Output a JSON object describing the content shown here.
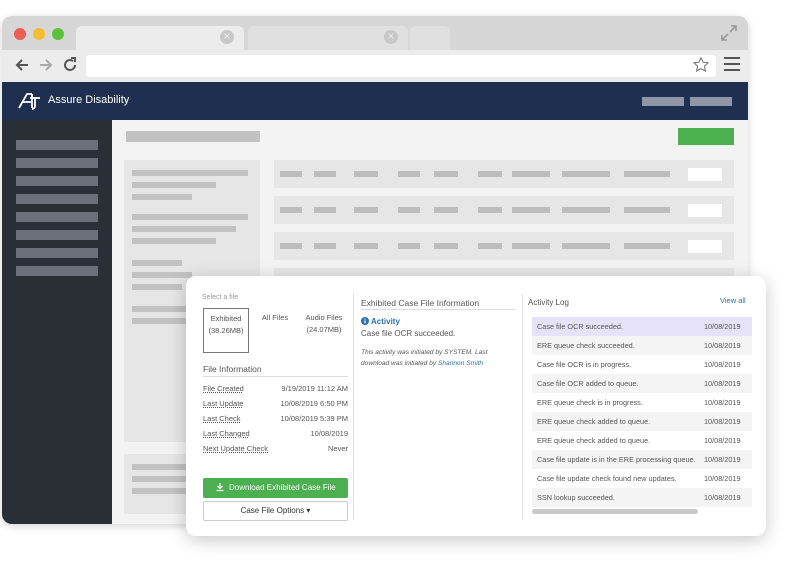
{
  "browser": {
    "tab_close_glyph": "×",
    "colors": {
      "close": "#ee5c54",
      "minimize": "#f7bc2f",
      "maximize": "#59c23d"
    },
    "icons": [
      "back-arrow-icon",
      "forward-arrow-icon",
      "reload-icon",
      "star-icon",
      "hamburger-menu-icon",
      "expand-icon"
    ]
  },
  "app": {
    "brand": "Assure Disability",
    "colors": {
      "header": "#1e2f4f",
      "sidebar": "#2a2e35",
      "accent_green": "#4caf50",
      "link_blue": "#2a6fb5",
      "highlight": "#e6e2fa"
    }
  },
  "file_panel": {
    "select_label": "Select a file",
    "tabs": [
      {
        "label": "Exhibited",
        "size": "(38.26MB)"
      },
      {
        "label": "All Files",
        "size": ""
      },
      {
        "label": "Audio Files",
        "size": "(24.07MB)"
      }
    ],
    "info_title": "File Information",
    "info": [
      {
        "label": "File Created",
        "value": "9/19/2019 11:12 AM"
      },
      {
        "label": "Last Update",
        "value": "10/08/2019 6:50 PM"
      },
      {
        "label": "Last Check",
        "value": "10/08/2019 5:39 PM"
      },
      {
        "label": "Last Changed",
        "value": "10/08/2019"
      },
      {
        "label": "Next Update Check",
        "value": "Never"
      }
    ],
    "download_button": "Download Exhibited Case File",
    "options_button": "Case File Options ▾"
  },
  "exhibited_info": {
    "title": "Exhibited Case File Information",
    "activity_label": "Activity",
    "activity_text": "Case file OCR succeeded.",
    "note_prefix": "This activity was initiated by SYSTEM. Last download was initiated by ",
    "note_user": "Shannon Smith"
  },
  "activity_log": {
    "title": "Activity Log",
    "view_all": "View all",
    "entries": [
      {
        "message": "Case file OCR succeeded.",
        "date": "10/08/2019",
        "highlighted": true
      },
      {
        "message": "ERE queue check succeeded.",
        "date": "10/08/2019",
        "highlighted": false
      },
      {
        "message": "Case file OCR is in progress.",
        "date": "10/08/2019",
        "highlighted": false
      },
      {
        "message": "Case file OCR added to queue.",
        "date": "10/08/2019",
        "highlighted": false
      },
      {
        "message": "ERE queue check is in progress.",
        "date": "10/08/2019",
        "highlighted": false
      },
      {
        "message": "ERE queue check added to queue.",
        "date": "10/08/2019",
        "highlighted": false
      },
      {
        "message": "ERE queue check added to queue.",
        "date": "10/08/2019",
        "highlighted": false
      },
      {
        "message": "Case file update is in the ERE processing queue.",
        "date": "10/08/2019",
        "highlighted": false
      },
      {
        "message": "Case file update check found new updates.",
        "date": "10/08/2019",
        "highlighted": false
      },
      {
        "message": "SSN lookup succeeded.",
        "date": "10/08/2019",
        "highlighted": false
      }
    ]
  }
}
